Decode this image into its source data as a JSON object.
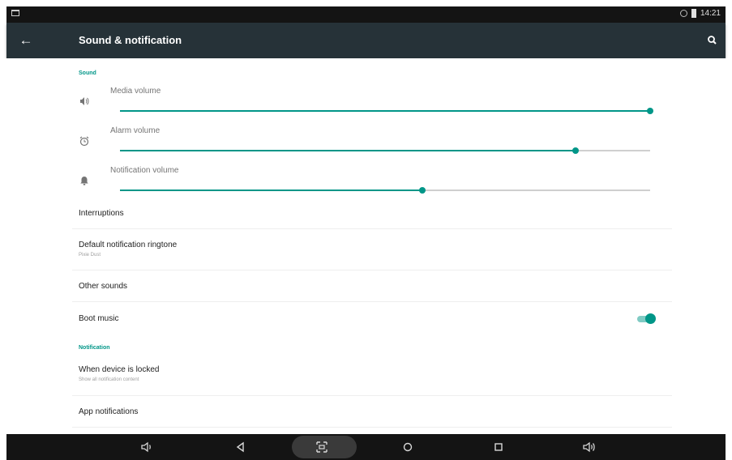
{
  "status_bar": {
    "time": "14:21"
  },
  "app_bar": {
    "title": "Sound & notification"
  },
  "sound_section": {
    "header": "Sound",
    "volumes": [
      {
        "label": "Media volume",
        "icon": "volume-icon",
        "level": 1.0
      },
      {
        "label": "Alarm volume",
        "icon": "alarm-clock-icon",
        "level": 0.86
      },
      {
        "label": "Notification volume",
        "icon": "bell-icon",
        "level": 0.57
      }
    ],
    "items": [
      {
        "title": "Interruptions"
      },
      {
        "title": "Default notification ringtone",
        "summary": "Pixie Dust"
      },
      {
        "title": "Other sounds"
      },
      {
        "title": "Boot music",
        "toggle": true
      }
    ]
  },
  "notification_section": {
    "header": "Notification",
    "items": [
      {
        "title": "When device is locked",
        "summary": "Show all notification content"
      },
      {
        "title": "App notifications"
      }
    ]
  },
  "colors": {
    "accent": "#009688",
    "app_bar": "#263238",
    "status_bar": "#141414"
  },
  "nav_bar": {
    "icons": [
      "volume-down-icon",
      "back-icon",
      "screenshot-icon",
      "home-icon",
      "recents-icon",
      "volume-up-icon"
    ]
  }
}
